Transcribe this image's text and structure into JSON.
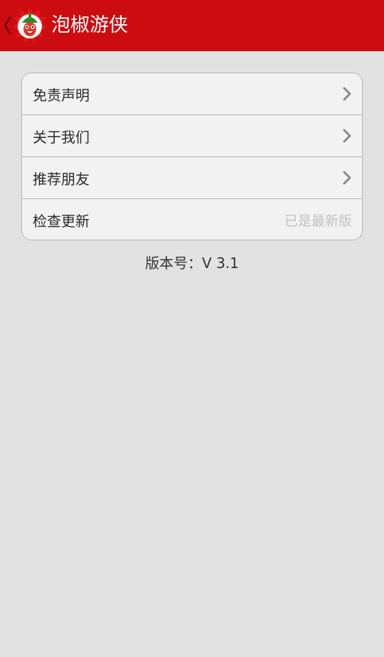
{
  "header": {
    "title": "泡椒游侠",
    "back_icon": "chevron-left-icon",
    "logo_icon": "pepper-mascot-logo-icon",
    "background_color": "#cc0c10"
  },
  "menu": {
    "items": [
      {
        "label": "免责声明",
        "trailing_icon": "chevron-right-icon"
      },
      {
        "label": "关于我们",
        "trailing_icon": "chevron-right-icon"
      },
      {
        "label": "推荐朋友",
        "trailing_icon": "chevron-right-icon"
      },
      {
        "label": "检查更新",
        "status": "已是最新版"
      }
    ]
  },
  "version": {
    "text": "版本号：V 3.1"
  }
}
